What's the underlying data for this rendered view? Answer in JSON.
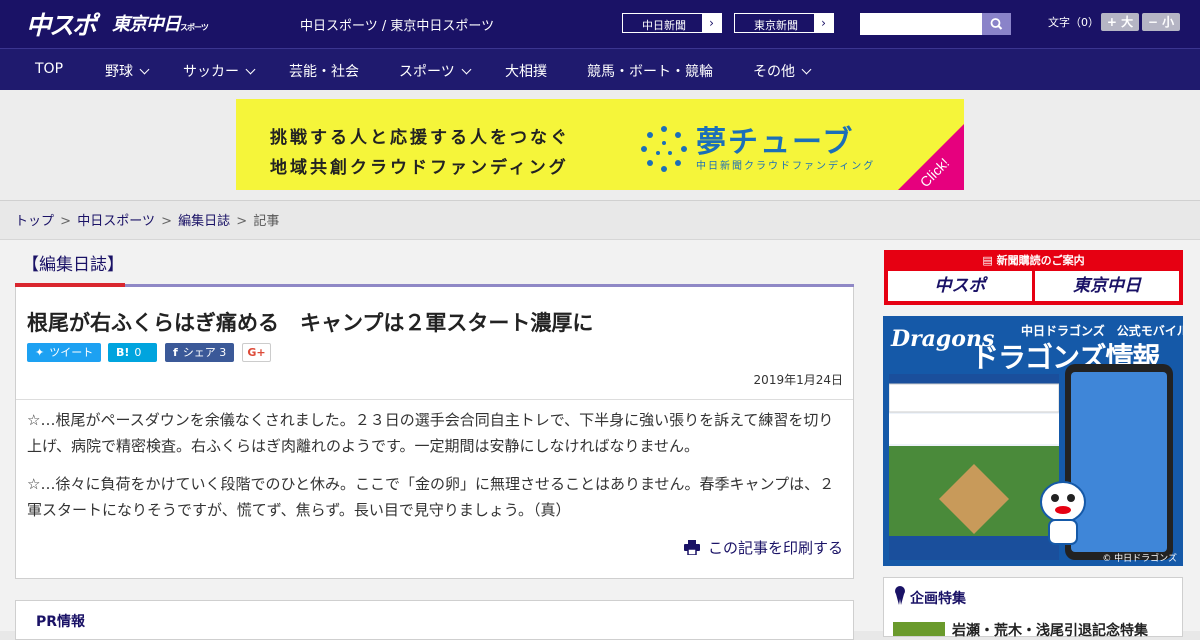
{
  "header": {
    "logo_chusupo": "中スポ",
    "logo_tokyo": "東京中日",
    "logo_tokyo_suffix": "スポーツ",
    "site_links": "中日スポーツ / 東京中日スポーツ",
    "paper_buttons": [
      "中日新聞",
      "東京新聞"
    ],
    "search_placeholder": "",
    "font_size_label": "文字（0）",
    "font_large": "+ 大",
    "font_small": "− 小"
  },
  "nav": [
    {
      "label": "TOP",
      "dropdown": false
    },
    {
      "label": "野球",
      "dropdown": true
    },
    {
      "label": "サッカー",
      "dropdown": true
    },
    {
      "label": "芸能・社会",
      "dropdown": false
    },
    {
      "label": "スポーツ",
      "dropdown": true
    },
    {
      "label": "大相撲",
      "dropdown": false
    },
    {
      "label": "競馬・ボート・競輪",
      "dropdown": false
    },
    {
      "label": "その他",
      "dropdown": true
    }
  ],
  "banner": {
    "line1": "挑戦する人と応援する人をつなぐ",
    "line2": "地域共創クラウドファンディング",
    "brand": "夢チューブ",
    "brand_sub": "中日新聞クラウドファンディング",
    "click": "Click!",
    "bg_color": "#f5f53a",
    "accent": "#e6007e"
  },
  "breadcrumb": {
    "items": [
      "トップ",
      "中日スポーツ",
      "編集日誌"
    ],
    "current": "記事",
    "separator": ">"
  },
  "section": {
    "heading": "【編集日誌】"
  },
  "article": {
    "title": "根尾が右ふくらはぎ痛める　キャンプは２軍スタート濃厚に",
    "share": {
      "tweet": "ツイート",
      "hatena_count": "0",
      "facebook_label": "シェア",
      "facebook_count": "3",
      "gplus": "G+"
    },
    "date": "2019年1月24日",
    "paragraphs": [
      "☆…根尾がペースダウンを余儀なくされました。２３日の選手会合同自主トレで、下半身に強い張りを訴えて練習を切り上げ、病院で精密検査。右ふくらはぎ肉離れのようです。一定期間は安静にしなければなりません。",
      "☆…徐々に負荷をかけていく段階でのひと休み。ここで「金の卵」に無理させることはありません。春季キャンプは、２軍スタートになりそうですが、慌てず、焦らず。長い目で見守りましょう。（真）"
    ],
    "print_label": "この記事を印刷する"
  },
  "pr": {
    "title": "PR情報"
  },
  "sidebar": {
    "subscription_title": "新聞購読のご案内",
    "subscription_buttons": [
      "中スポ",
      "東京中日"
    ],
    "dragons_logo": "Dragons",
    "dragons_sub": "中日ドラゴンズ　公式モバイルサイト",
    "dragons_title": "ドラゴンズ情報",
    "dragons_copyright": "© 中日ドラゴンズ",
    "feature_title": "企画特集",
    "feature_item": "岩瀬・荒木・浅尾引退記念特集"
  },
  "colors": {
    "header_bg": "#1a1266",
    "nav_bg": "#1f1a6e",
    "link": "#1a1266",
    "section_red": "#d9262e",
    "section_purple": "#8f88c6"
  }
}
